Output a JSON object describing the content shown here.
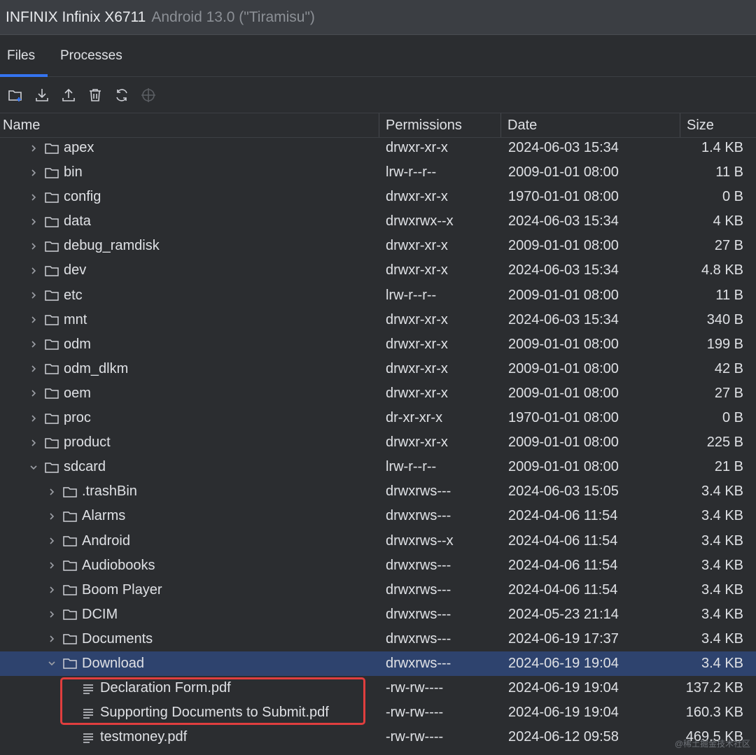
{
  "window": {
    "device": "INFINIX Infinix X6711",
    "os": "Android 13.0 (\"Tiramisu\")"
  },
  "tabs": [
    {
      "label": "Files",
      "active": true
    },
    {
      "label": "Processes",
      "active": false
    }
  ],
  "toolbar": [
    {
      "icon": "new-folder-icon"
    },
    {
      "icon": "download-icon"
    },
    {
      "icon": "upload-icon"
    },
    {
      "icon": "trash-icon"
    },
    {
      "icon": "refresh-icon"
    },
    {
      "icon": "locate-icon"
    }
  ],
  "columns": {
    "name": "Name",
    "permissions": "Permissions",
    "date": "Date",
    "size": "Size"
  },
  "rows": [
    {
      "name": "apex",
      "type": "folder",
      "depth": 0,
      "expanded": false,
      "permissions": "drwxr-xr-x",
      "date": "2024-06-03 15:34",
      "size": "1.4 KB"
    },
    {
      "name": "bin",
      "type": "folder",
      "depth": 0,
      "expanded": false,
      "permissions": "lrw-r--r--",
      "date": "2009-01-01 08:00",
      "size": "11 B"
    },
    {
      "name": "config",
      "type": "folder",
      "depth": 0,
      "expanded": false,
      "permissions": "drwxr-xr-x",
      "date": "1970-01-01 08:00",
      "size": "0 B"
    },
    {
      "name": "data",
      "type": "folder",
      "depth": 0,
      "expanded": false,
      "permissions": "drwxrwx--x",
      "date": "2024-06-03 15:34",
      "size": "4 KB"
    },
    {
      "name": "debug_ramdisk",
      "type": "folder",
      "depth": 0,
      "expanded": false,
      "permissions": "drwxr-xr-x",
      "date": "2009-01-01 08:00",
      "size": "27 B"
    },
    {
      "name": "dev",
      "type": "folder",
      "depth": 0,
      "expanded": false,
      "permissions": "drwxr-xr-x",
      "date": "2024-06-03 15:34",
      "size": "4.8 KB"
    },
    {
      "name": "etc",
      "type": "folder",
      "depth": 0,
      "expanded": false,
      "permissions": "lrw-r--r--",
      "date": "2009-01-01 08:00",
      "size": "11 B"
    },
    {
      "name": "mnt",
      "type": "folder",
      "depth": 0,
      "expanded": false,
      "permissions": "drwxr-xr-x",
      "date": "2024-06-03 15:34",
      "size": "340 B"
    },
    {
      "name": "odm",
      "type": "folder",
      "depth": 0,
      "expanded": false,
      "permissions": "drwxr-xr-x",
      "date": "2009-01-01 08:00",
      "size": "199 B"
    },
    {
      "name": "odm_dlkm",
      "type": "folder",
      "depth": 0,
      "expanded": false,
      "permissions": "drwxr-xr-x",
      "date": "2009-01-01 08:00",
      "size": "42 B"
    },
    {
      "name": "oem",
      "type": "folder",
      "depth": 0,
      "expanded": false,
      "permissions": "drwxr-xr-x",
      "date": "2009-01-01 08:00",
      "size": "27 B"
    },
    {
      "name": "proc",
      "type": "folder",
      "depth": 0,
      "expanded": false,
      "permissions": "dr-xr-xr-x",
      "date": "1970-01-01 08:00",
      "size": "0 B"
    },
    {
      "name": "product",
      "type": "folder",
      "depth": 0,
      "expanded": false,
      "permissions": "drwxr-xr-x",
      "date": "2009-01-01 08:00",
      "size": "225 B"
    },
    {
      "name": "sdcard",
      "type": "folder",
      "depth": 0,
      "expanded": true,
      "permissions": "lrw-r--r--",
      "date": "2009-01-01 08:00",
      "size": "21 B"
    },
    {
      "name": ".trashBin",
      "type": "folder",
      "depth": 1,
      "expanded": false,
      "permissions": "drwxrws---",
      "date": "2024-06-03 15:05",
      "size": "3.4 KB"
    },
    {
      "name": "Alarms",
      "type": "folder",
      "depth": 1,
      "expanded": false,
      "permissions": "drwxrws---",
      "date": "2024-04-06 11:54",
      "size": "3.4 KB"
    },
    {
      "name": "Android",
      "type": "folder",
      "depth": 1,
      "expanded": false,
      "permissions": "drwxrws--x",
      "date": "2024-04-06 11:54",
      "size": "3.4 KB"
    },
    {
      "name": "Audiobooks",
      "type": "folder",
      "depth": 1,
      "expanded": false,
      "permissions": "drwxrws---",
      "date": "2024-04-06 11:54",
      "size": "3.4 KB"
    },
    {
      "name": "Boom Player",
      "type": "folder",
      "depth": 1,
      "expanded": false,
      "permissions": "drwxrws---",
      "date": "2024-04-06 11:54",
      "size": "3.4 KB"
    },
    {
      "name": "DCIM",
      "type": "folder",
      "depth": 1,
      "expanded": false,
      "permissions": "drwxrws---",
      "date": "2024-05-23 21:14",
      "size": "3.4 KB"
    },
    {
      "name": "Documents",
      "type": "folder",
      "depth": 1,
      "expanded": false,
      "permissions": "drwxrws---",
      "date": "2024-06-19 17:37",
      "size": "3.4 KB"
    },
    {
      "name": "Download",
      "type": "folder",
      "depth": 1,
      "expanded": true,
      "selected": true,
      "permissions": "drwxrws---",
      "date": "2024-06-19 19:04",
      "size": "3.4 KB"
    },
    {
      "name": "Declaration Form.pdf",
      "type": "file",
      "depth": 2,
      "permissions": "-rw-rw----",
      "date": "2024-06-19 19:04",
      "size": "137.2 KB"
    },
    {
      "name": "Supporting Documents to Submit.pdf",
      "type": "file",
      "depth": 2,
      "permissions": "-rw-rw----",
      "date": "2024-06-19 19:04",
      "size": "160.3 KB"
    },
    {
      "name": "testmoney.pdf",
      "type": "file",
      "depth": 2,
      "permissions": "-rw-rw----",
      "date": "2024-06-12 09:58",
      "size": "469.5 KB"
    }
  ],
  "colors": {
    "selection": "#2e436e",
    "accent": "#3574f0",
    "highlight_box": "#e03e3e"
  },
  "watermark": "@稀土掘金技术社区"
}
